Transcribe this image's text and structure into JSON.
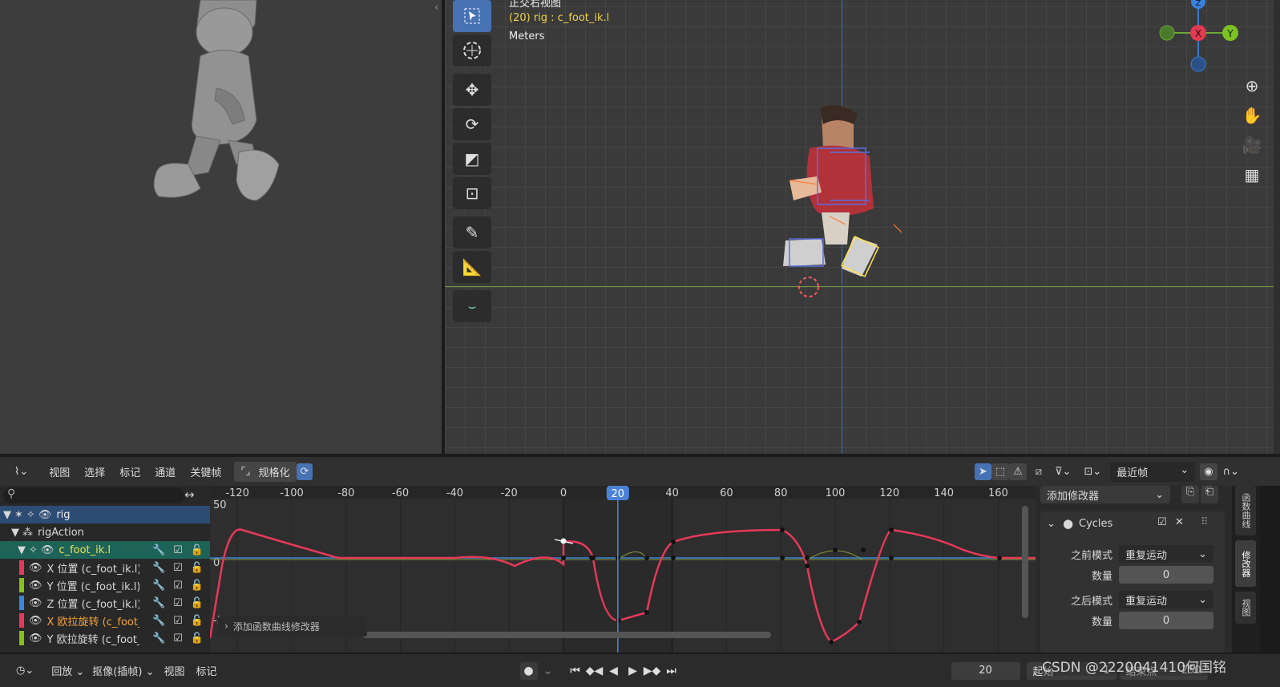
{
  "viewport_right": {
    "view_name": "正交右视图",
    "object_info": "(20) rig : c_foot_ik.l",
    "units": "Meters",
    "gizmo": {
      "x": "X",
      "y": "Y",
      "z": "Z"
    }
  },
  "graph_header": {
    "menus": [
      "视图",
      "选择",
      "标记",
      "通道",
      "关键帧"
    ],
    "normalize_label": "规格化",
    "pivot_select": "最近帧"
  },
  "channels": {
    "rig": "rig",
    "action": "rigAction",
    "bone": "c_foot_ik.l",
    "items": [
      {
        "label": "X 位置 (c_foot_ik.l)",
        "color": "#e8385a"
      },
      {
        "label": "Y 位置 (c_foot_ik.l)",
        "color": "#84c21b"
      },
      {
        "label": "Z 位置 (c_foot_ik.l)",
        "color": "#3a86d8"
      },
      {
        "label": "X 欧拉旋转 (c_foot_ik.l)",
        "color": "#e8385a"
      },
      {
        "label": "Y 欧拉旋转 (c_foot_ik.l)",
        "color": "#84c21b"
      }
    ]
  },
  "graph": {
    "x_ticks": [
      "-120",
      "-100",
      "-80",
      "-60",
      "-40",
      "-20",
      "0",
      "20",
      "40",
      "60",
      "80",
      "100",
      "120",
      "140",
      "160"
    ],
    "current_frame": "20",
    "y_labels": [
      "50",
      "0",
      "-50"
    ],
    "context_popup": "添加函数曲线修改器"
  },
  "sidebar": {
    "add_modifier": "添加修改器",
    "modifier_name": "Cycles",
    "before_mode_label": "之前模式",
    "before_mode_value": "重复运动",
    "before_count_label": "数量",
    "before_count_value": "0",
    "after_mode_label": "之后模式",
    "after_mode_value": "重复运动",
    "after_count_label": "数量",
    "after_count_value": "0",
    "tabs": [
      "函数曲线",
      "修改器",
      "视图"
    ]
  },
  "timeline": {
    "playback": "回放",
    "keying": "抠像(插帧)",
    "view": "视图",
    "marker": "标记",
    "current_frame": "20",
    "start_label": "起始",
    "start_value": "1",
    "end_label": "结束点",
    "end_value": "250"
  },
  "watermark": "CSDN @2220041410何国铭"
}
